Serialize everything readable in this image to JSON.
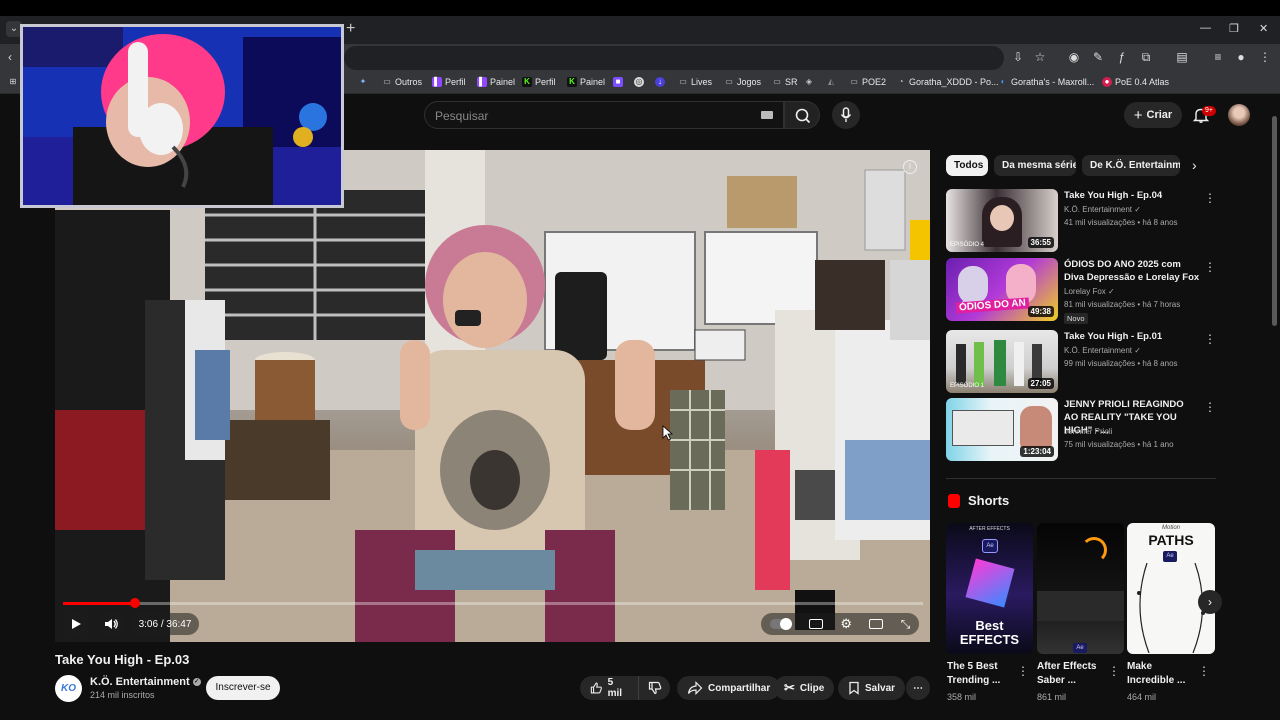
{
  "browser": {
    "tab_menu_icon": "chevron-down-icon",
    "new_tab_label": "+",
    "bookmarks": [
      {
        "label": "Outros",
        "icon": "folder-icon"
      },
      {
        "label": "Perfil",
        "icon": "twitch-icon"
      },
      {
        "label": "Painel",
        "icon": "twitch-icon"
      },
      {
        "label": "Perfil",
        "icon": "kick-icon"
      },
      {
        "label": "Painel",
        "icon": "kick-icon"
      },
      {
        "label": "Lives",
        "icon": "folder-icon"
      },
      {
        "label": "Jogos",
        "icon": "folder-icon"
      },
      {
        "label": "SR",
        "icon": "folder-icon"
      },
      {
        "label": "POE2",
        "icon": "folder-icon"
      },
      {
        "label": "Goratha_XDDD - Po...",
        "icon": "poe-icon"
      },
      {
        "label": "Goratha's - Maxroll...",
        "icon": "maxroll-icon"
      },
      {
        "label": "PoE 0.4 Atlas",
        "icon": "poe-atlas-icon"
      }
    ]
  },
  "header": {
    "search_placeholder": "Pesquisar",
    "create_label": "Criar",
    "notification_count": "9+"
  },
  "player": {
    "time": "3:06 / 36:47",
    "progress_fraction": 0.084
  },
  "video": {
    "title": "Take You High - Ep.03",
    "channel_name": "K.Ö. Entertainment",
    "channel_avatar_text": "KO",
    "subscribers": "214 mil inscritos",
    "subscribe_label": "Inscrever-se",
    "likes": "5 mil",
    "share_label": "Compartilhar",
    "clip_label": "Clipe",
    "save_label": "Salvar"
  },
  "chips": [
    "Todos",
    "Da mesma série",
    "De K.Ö. Entertainment"
  ],
  "related": [
    {
      "title": "Take You High - Ep.04",
      "channel": "K.Ö. Entertainment",
      "meta": "41 mil visualizações • há 8 anos",
      "duration": "36:55",
      "badge": ""
    },
    {
      "title": "ÓDIOS DO ANO 2025 com Diva Depressão e Lorelay Fox",
      "channel": "Lorelay Fox",
      "meta": "81 mil visualizações • há 7 horas",
      "duration": "49:38",
      "badge": "Novo"
    },
    {
      "title": "Take You High - Ep.01",
      "channel": "K.Ö. Entertainment",
      "meta": "99 mil visualizações • há 8 anos",
      "duration": "27:05",
      "badge": ""
    },
    {
      "title": "JENNY PRIOLI REAGINDO AO REALITY \"TAKE YOU HIGH\" - ...",
      "channel": "Jennifer Prioli",
      "meta": "75 mil visualizações • há 1 ano",
      "duration": "1:23:04",
      "badge": ""
    }
  ],
  "shorts": {
    "label": "Shorts",
    "items": [
      {
        "title": "The 5 Best Trending ...",
        "views": "358 mil",
        "thumb_text": "Best EFFECTS",
        "thumb_top": "AFTER EFFECTS"
      },
      {
        "title": "After Effects Saber ...",
        "views": "861 mil",
        "thumb_text": "",
        "thumb_top": ""
      },
      {
        "title": "Make Incredible ...",
        "views": "464 mil",
        "thumb_text": "PATHS",
        "thumb_top": "Motion"
      }
    ]
  },
  "colors": {
    "accent": "#ff0000",
    "background": "#0f0f0f"
  }
}
